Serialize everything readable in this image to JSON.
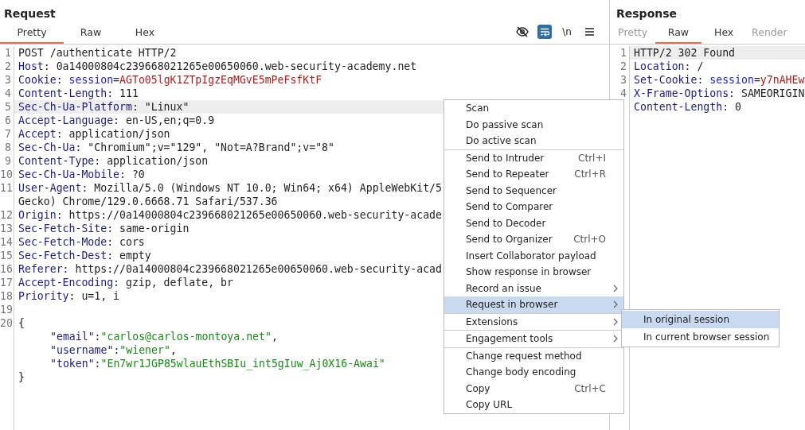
{
  "request": {
    "title": "Request",
    "tabs": [
      {
        "label": "Pretty",
        "selected": true,
        "disabled": false
      },
      {
        "label": "Raw",
        "selected": false,
        "disabled": false
      },
      {
        "label": "Hex",
        "selected": false,
        "disabled": false
      }
    ],
    "toolbar": [
      {
        "kind": "eye-off",
        "selected": false
      },
      {
        "kind": "wrap",
        "selected": true
      },
      {
        "kind": "newline",
        "label": "\\n",
        "selected": false
      },
      {
        "kind": "menu",
        "selected": false
      }
    ],
    "lines": [
      {
        "number": "1",
        "selected": false,
        "segments": [
          {
            "kind": "plain",
            "text": "POST /authenticate HTTP/2"
          }
        ]
      },
      {
        "number": "2",
        "selected": false,
        "segments": [
          {
            "kind": "key",
            "text": "Host"
          },
          {
            "kind": "plain",
            "text": ": 0a14000804c239668021265e00650060.web-security-academy.net"
          }
        ]
      },
      {
        "number": "3",
        "selected": false,
        "segments": [
          {
            "kind": "key",
            "text": "Cookie"
          },
          {
            "kind": "plain",
            "text": ": "
          },
          {
            "kind": "cookie-name",
            "text": "session"
          },
          {
            "kind": "plain",
            "text": "="
          },
          {
            "kind": "cookie-value",
            "text": "AGTo05lgK1ZTpIgzEqMGvE5mPeFsfKtF"
          }
        ]
      },
      {
        "number": "4",
        "selected": false,
        "segments": [
          {
            "kind": "key",
            "text": "Content-Length"
          },
          {
            "kind": "plain",
            "text": ": 111"
          }
        ]
      },
      {
        "number": "5",
        "selected": true,
        "segments": [
          {
            "kind": "key",
            "text": "Sec-Ch-Ua-Platform"
          },
          {
            "kind": "plain",
            "text": ": \"Linux\""
          }
        ]
      },
      {
        "number": "6",
        "selected": false,
        "segments": [
          {
            "kind": "key",
            "text": "Accept-Language"
          },
          {
            "kind": "plain",
            "text": ": en-US,en;q=0.9"
          }
        ]
      },
      {
        "number": "7",
        "selected": false,
        "segments": [
          {
            "kind": "key",
            "text": "Accept"
          },
          {
            "kind": "plain",
            "text": ": application/json"
          }
        ]
      },
      {
        "number": "8",
        "selected": false,
        "segments": [
          {
            "kind": "key",
            "text": "Sec-Ch-Ua"
          },
          {
            "kind": "plain",
            "text": ": \"Chromium\";v=\"129\", \"Not=A?Brand\";v=\"8\""
          }
        ]
      },
      {
        "number": "9",
        "selected": false,
        "segments": [
          {
            "kind": "key",
            "text": "Content-Type"
          },
          {
            "kind": "plain",
            "text": ": application/json"
          }
        ]
      },
      {
        "number": "10",
        "selected": false,
        "segments": [
          {
            "kind": "key",
            "text": "Sec-Ch-Ua-Mobile"
          },
          {
            "kind": "plain",
            "text": ": ?0"
          }
        ]
      },
      {
        "number": "11",
        "selected": false,
        "segments": [
          {
            "kind": "key",
            "text": "User-Agent"
          },
          {
            "kind": "plain",
            "text": ": Mozilla/5.0 (Windows NT 10.0; Win64; x64) AppleWebKit/5"
          }
        ]
      },
      {
        "selected": false,
        "segments": [
          {
            "kind": "plain",
            "text": "Gecko) Chrome/129.0.6668.71 Safari/537.36"
          }
        ]
      },
      {
        "number": "12",
        "selected": false,
        "segments": [
          {
            "kind": "key",
            "text": "Origin"
          },
          {
            "kind": "plain",
            "text": ": https://0a14000804c239668021265e00650060.web-security-acade"
          }
        ]
      },
      {
        "number": "13",
        "selected": false,
        "segments": [
          {
            "kind": "key",
            "text": "Sec-Fetch-Site"
          },
          {
            "kind": "plain",
            "text": ": same-origin"
          }
        ]
      },
      {
        "number": "14",
        "selected": false,
        "segments": [
          {
            "kind": "key",
            "text": "Sec-Fetch-Mode"
          },
          {
            "kind": "plain",
            "text": ": cors"
          }
        ]
      },
      {
        "number": "15",
        "selected": false,
        "segments": [
          {
            "kind": "key",
            "text": "Sec-Fetch-Dest"
          },
          {
            "kind": "plain",
            "text": ": empty"
          }
        ]
      },
      {
        "number": "16",
        "selected": false,
        "segments": [
          {
            "kind": "key",
            "text": "Referer"
          },
          {
            "kind": "plain",
            "text": ": https://0a14000804c239668021265e00650060.web-security-acad"
          }
        ]
      },
      {
        "number": "17",
        "selected": false,
        "segments": [
          {
            "kind": "key",
            "text": "Accept-Encoding"
          },
          {
            "kind": "plain",
            "text": ": gzip, deflate, br"
          }
        ]
      },
      {
        "number": "18",
        "selected": false,
        "segments": [
          {
            "kind": "key",
            "text": "Priority"
          },
          {
            "kind": "plain",
            "text": ": u=1, i"
          }
        ]
      },
      {
        "number": "19",
        "selected": false
      },
      {
        "number": "20",
        "selected": false,
        "segments": [
          {
            "kind": "plain",
            "text": "{"
          }
        ],
        "children": [
          {
            "selected": false,
            "segments": [
              {
                "kind": "json-key",
                "text": "\"email\""
              },
              {
                "kind": "plain",
                "text": ":"
              },
              {
                "kind": "json-value",
                "text": "\"carlos@carlos-montoya.net\""
              },
              {
                "kind": "plain",
                "text": ","
              }
            ]
          },
          {
            "selected": false,
            "segments": [
              {
                "kind": "json-key",
                "text": "\"username\""
              },
              {
                "kind": "plain",
                "text": ":"
              },
              {
                "kind": "json-value",
                "text": "\"wiener\""
              },
              {
                "kind": "plain",
                "text": ","
              }
            ]
          },
          {
            "selected": false,
            "segments": [
              {
                "kind": "json-key",
                "text": "\"token\""
              },
              {
                "kind": "plain",
                "text": ":"
              },
              {
                "kind": "json-value",
                "text": "\"En7wr1JGP85wlauEthSBIu_int5gIuw_Aj0X16-Awai\""
              }
            ]
          }
        ]
      },
      {
        "selected": false,
        "segments": [
          {
            "kind": "plain",
            "text": "}"
          }
        ]
      }
    ]
  },
  "response": {
    "title": "Response",
    "tabs": [
      {
        "label": "Pretty",
        "selected": false,
        "disabled": true
      },
      {
        "label": "Raw",
        "selected": true,
        "disabled": false
      },
      {
        "label": "Hex",
        "selected": false,
        "disabled": false
      },
      {
        "label": "Render",
        "selected": false,
        "disabled": true
      }
    ],
    "lines": [
      {
        "number": "1",
        "selected": true,
        "segments": [
          {
            "kind": "plain",
            "text": "HTTP/2 302 Found"
          }
        ]
      },
      {
        "number": "2",
        "selected": false,
        "segments": [
          {
            "kind": "key",
            "text": "Location"
          },
          {
            "kind": "plain",
            "text": ": /"
          }
        ]
      },
      {
        "number": "3",
        "selected": false,
        "segments": [
          {
            "kind": "key",
            "text": "Set-Cookie"
          },
          {
            "kind": "plain",
            "text": ": "
          },
          {
            "kind": "cookie-name",
            "text": "session"
          },
          {
            "kind": "plain",
            "text": "="
          },
          {
            "kind": "cookie-value",
            "text": "y7nAHEw"
          }
        ]
      },
      {
        "number": "4",
        "selected": false,
        "segments": [
          {
            "kind": "key",
            "text": "X-Frame-Options"
          },
          {
            "kind": "plain",
            "text": ": SAMEORIGIN"
          }
        ]
      },
      {
        "selected": false,
        "segments": [
          {
            "kind": "key",
            "text": "Content-Length"
          },
          {
            "kind": "plain",
            "text": ": 0"
          }
        ]
      }
    ]
  },
  "context_menu": {
    "groups": [
      [
        {
          "label": "Scan",
          "selected": false,
          "submenu": false
        },
        {
          "label": "Do passive scan",
          "selected": false,
          "submenu": false
        },
        {
          "label": "Do active scan",
          "selected": false,
          "submenu": false
        }
      ],
      [
        {
          "label": "Send to Intruder",
          "shortcut": "Ctrl+I",
          "selected": false,
          "submenu": false
        },
        {
          "label": "Send to Repeater",
          "shortcut": "Ctrl+R",
          "selected": false,
          "submenu": false
        },
        {
          "label": "Send to Sequencer",
          "selected": false,
          "submenu": false
        },
        {
          "label": "Send to Comparer",
          "selected": false,
          "submenu": false
        },
        {
          "label": "Send to Decoder",
          "selected": false,
          "submenu": false
        },
        {
          "label": "Send to Organizer",
          "shortcut": "Ctrl+O",
          "selected": false,
          "submenu": false
        },
        {
          "label": "Insert Collaborator payload",
          "selected": false,
          "submenu": false
        },
        {
          "label": "Show response in browser",
          "selected": false,
          "submenu": false
        },
        {
          "label": "Record an issue",
          "selected": false,
          "submenu": true
        },
        {
          "label": "Request in browser",
          "selected": true,
          "submenu": true
        }
      ],
      [
        {
          "label": "Extensions",
          "selected": false,
          "submenu": true
        }
      ],
      [
        {
          "label": "Engagement tools",
          "selected": false,
          "submenu": true
        }
      ],
      [
        {
          "label": "Change request method",
          "selected": false,
          "submenu": false
        },
        {
          "label": "Change body encoding",
          "selected": false,
          "submenu": false
        },
        {
          "label": "Copy",
          "shortcut": "Ctrl+C",
          "selected": false,
          "submenu": false
        },
        {
          "label": "Copy URL",
          "selected": false,
          "submenu": false
        }
      ]
    ]
  },
  "submenu": {
    "items": [
      {
        "label": "In original session",
        "selected": true
      },
      {
        "label": "In current browser session",
        "selected": false
      }
    ]
  }
}
